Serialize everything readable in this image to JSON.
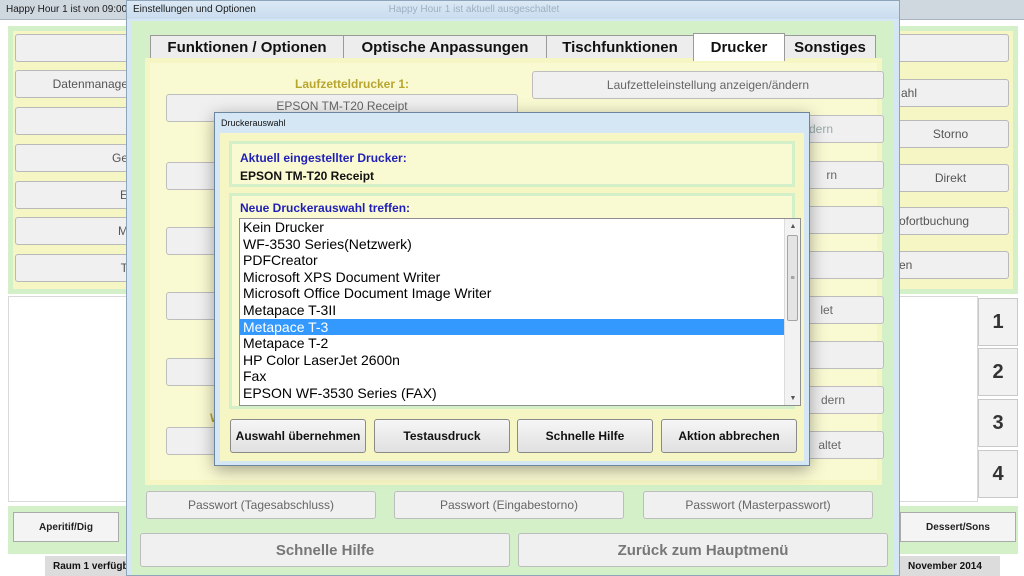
{
  "background_app": {
    "title": "Happy Hour 1 ist von 09:00 Uhr",
    "left_buttons": [
      "",
      "Datenmanage",
      "",
      "Ge",
      "E",
      "M",
      "T"
    ],
    "right_buttons": [
      "",
      "ahl",
      "Storno",
      "Direkt",
      "ofortbuchung",
      "en"
    ],
    "number_buttons": [
      "1",
      "2",
      "3",
      "4"
    ],
    "bottom_left_button": "Aperitif/Dig",
    "bottom_right_button": "Dessert/Sons",
    "status_left": "Raum 1 verfügb",
    "status_right": "November 2014"
  },
  "settings_window": {
    "title": "Einstellungen und Optionen",
    "ghost_title": "Happy Hour 1 ist aktuell ausgeschaltet",
    "tabs": [
      {
        "label": "Funktionen / Optionen",
        "active": false
      },
      {
        "label": "Optische Anpassungen",
        "active": false
      },
      {
        "label": "Tischfunktionen",
        "active": false
      },
      {
        "label": "Drucker",
        "active": true
      },
      {
        "label": "Sonstiges",
        "active": false
      }
    ],
    "panel": {
      "printer1_label": "Laufzetteldrucker 1:",
      "printer1_value": "EPSON TM-T20 Receipt",
      "partial_label": "W",
      "right_buttons": [
        "Laufzetteleinstellung anzeigen/ändern",
        "Laufzettel Sofortausdruck anzeigen/ändern",
        "rn",
        "",
        "",
        "let",
        "",
        "dern",
        "altet"
      ]
    },
    "password_buttons": [
      "Passwort (Tagesabschluss)",
      "Passwort (Eingabestorno)",
      "Passwort (Masterpasswort)"
    ],
    "help_button": "Schnelle Hilfe",
    "back_button": "Zurück zum Hauptmenü"
  },
  "printer_dialog": {
    "title": "Druckerauswahl",
    "current_label": "Aktuell eingestellter Drucker:",
    "current_printer": "EPSON TM-T20 Receipt",
    "new_label": "Neue Druckerauswahl treffen:",
    "printers": [
      "Kein Drucker",
      "WF-3530 Series(Netzwerk)",
      "PDFCreator",
      "Microsoft XPS Document Writer",
      "Microsoft Office Document Image Writer",
      "Metapace T-3II",
      "Metapace T-3",
      "Metapace T-2",
      "HP Color LaserJet 2600n",
      "Fax",
      "EPSON WF-3530 Series (FAX)"
    ],
    "selected_printer": "Metapace T-3",
    "buttons": {
      "apply": "Auswahl übernehmen",
      "test": "Testausdruck",
      "help": "Schnelle Hilfe",
      "cancel": "Aktion abbrechen"
    },
    "scroll_up_glyph": "▲",
    "scroll_down_glyph": "▼",
    "scroll_grip_glyph": "≡"
  }
}
